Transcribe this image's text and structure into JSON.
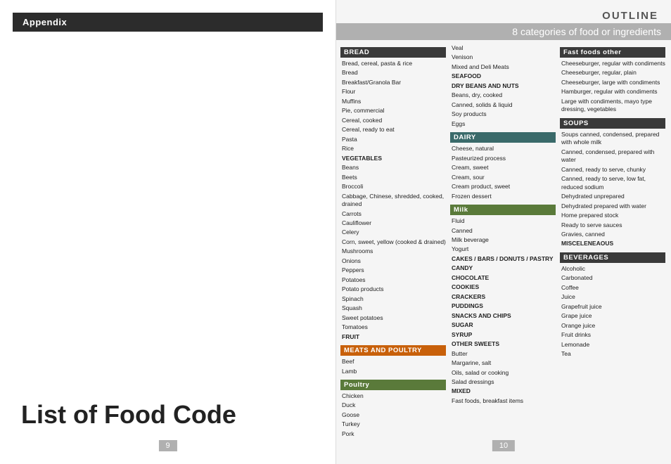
{
  "left": {
    "appendix_label": "Appendix",
    "page_title": "List of Food Code",
    "page_num": "9"
  },
  "right": {
    "outline_label": "OUTLINE",
    "subtitle": "8 categories of food or ingredients",
    "page_num": "10",
    "col1": {
      "categories": [
        {
          "header": "BREAD",
          "header_style": "dark",
          "items": [
            "Bread, cereal, pasta & rice",
            "Bread",
            "Breakfast/Granola Bar",
            "Flour",
            "Muffins",
            "Pie, commercial",
            "Cereal, cooked",
            "Cereal, ready to eat",
            "Pasta",
            "Rice",
            "VEGETABLES",
            "Beans",
            "Beets",
            "Broccoli",
            "Cabbage, Chinese, shredded, cooked, drained",
            "Carrots",
            "Cauliflower",
            "Celery",
            "Corn, sweet, yellow (cooked & drained)",
            "Mushrooms",
            "Onions",
            "Peppers",
            "Potatoes",
            "Potato products",
            "Spinach",
            "Squash",
            "Sweet potatoes",
            "Tomatoes",
            "FRUIT"
          ]
        },
        {
          "header": "MEATS AND POULTRY",
          "header_style": "orange",
          "items": [
            "Beef",
            "Lamb"
          ]
        },
        {
          "header": "Poultry",
          "header_style": "green",
          "items": [
            "Chicken",
            "Duck",
            "Goose",
            "Turkey",
            "Pork"
          ]
        }
      ]
    },
    "col2": {
      "categories": [
        {
          "header": "",
          "header_style": "none",
          "items": [
            "Veal",
            "Venison",
            "Mixed and Deli Meats",
            "SEAFOOD",
            "DRY BEANS AND NUTS",
            "Beans, dry, cooked",
            "Canned, solids & liquid",
            "Soy products",
            "Eggs"
          ]
        },
        {
          "header": "DAIRY",
          "header_style": "teal",
          "items": [
            "Cheese, natural",
            "Pasteurized process",
            "Cream, sweet",
            "Cream, sour",
            "Cream product, sweet",
            "Frozen dessert"
          ]
        },
        {
          "header": "Milk",
          "header_style": "green",
          "items": [
            "Fluid",
            "Canned",
            "Milk beverage",
            "Yogurt",
            "CAKES / BARS / DONUTS / PASTRY",
            "CANDY",
            "CHOCOLATE",
            "COOKIES",
            "CRACKERS",
            "PUDDINGS",
            "SNACKS AND CHIPS",
            "SUGAR",
            "SYRUP",
            "OTHER SWEETS",
            "Butter",
            "Margarine, salt",
            "Oils, salad or cooking",
            "Salad dressings",
            "MIXED",
            "Fast foods, breakfast items"
          ]
        }
      ]
    },
    "col3": {
      "categories": [
        {
          "header": "Fast foods other",
          "header_style": "dark",
          "items": [
            "Cheeseburger, regular with condiments",
            "Cheeseburger, regular, plain",
            "Cheeseburger, large with condiments",
            "Hamburger, regular with condiments",
            "Large with condiments, mayo type dressing, vegetables"
          ]
        },
        {
          "header": "SOUPS",
          "header_style": "dark",
          "items": [
            "Soups canned, condensed, prepared with whole milk",
            "Canned, condensed, prepared with water",
            "Canned, ready to serve, chunky",
            "Canned, ready to serve, low fat, reduced sodium",
            "Dehydrated unprepared",
            "Dehydrated prepared with water",
            "Home prepared stock",
            "Ready to serve sauces",
            "Gravies, canned",
            "MISCELENEAOUS"
          ]
        },
        {
          "header": "BEVERAGES",
          "header_style": "dark",
          "items": [
            "Alcoholic",
            "Carbonated",
            "Coffee",
            "Juice",
            "Grapefruit juice",
            "Grape juice",
            "Orange juice",
            "Fruit drinks",
            "Lemonade",
            "Tea"
          ]
        }
      ]
    }
  }
}
